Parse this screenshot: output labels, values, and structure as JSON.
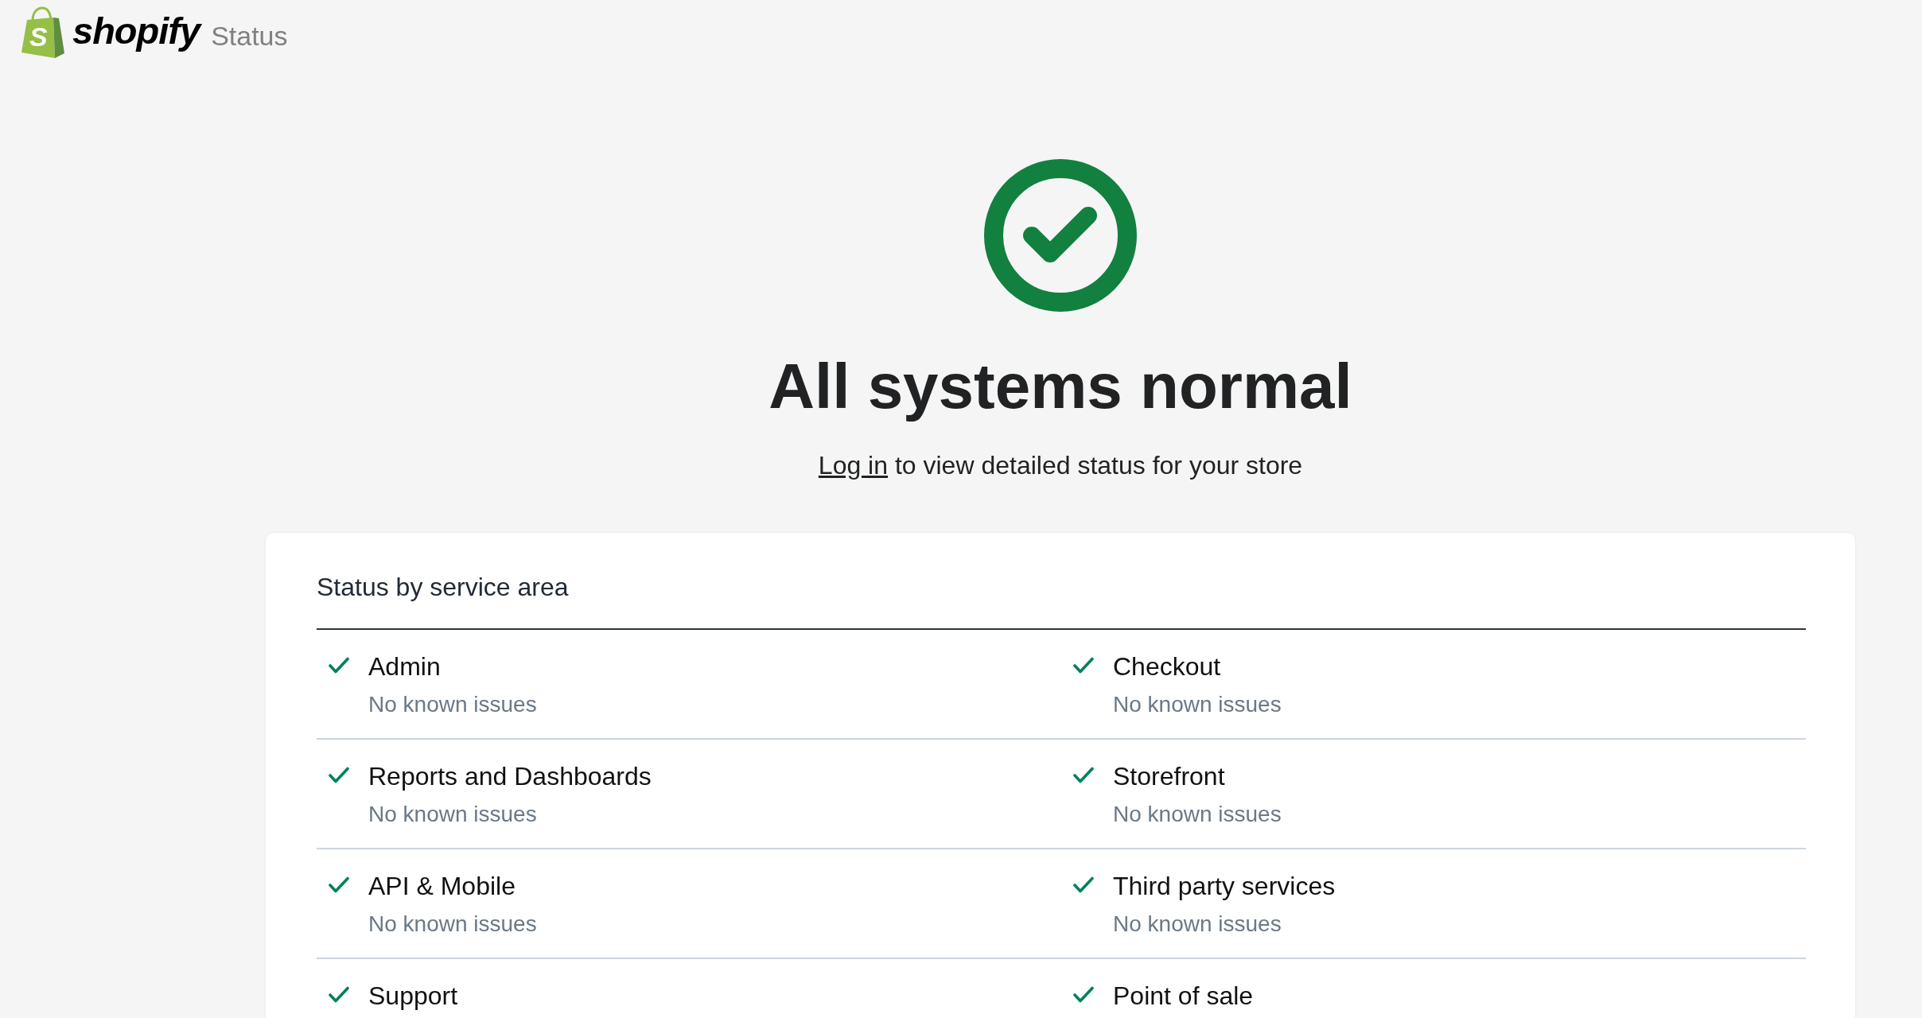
{
  "header": {
    "logo_mark": "S",
    "wordmark": "shopify",
    "product": "Status"
  },
  "hero": {
    "operational": true,
    "title": "All systems normal",
    "login_link": "Log in",
    "login_text": "to view detailed status for your store"
  },
  "card": {
    "title": "Status by service area",
    "services": [
      {
        "name": "Admin",
        "operational": true,
        "description": "No known issues"
      },
      {
        "name": "Checkout",
        "operational": true,
        "description": "No known issues"
      },
      {
        "name": "Reports and Dashboards",
        "operational": true,
        "description": "No known issues"
      },
      {
        "name": "Storefront",
        "operational": true,
        "description": "No known issues"
      },
      {
        "name": "API & Mobile",
        "operational": true,
        "description": "No known issues"
      },
      {
        "name": "Third party services",
        "operational": true,
        "description": "No known issues"
      },
      {
        "name": "Support",
        "operational": true
      },
      {
        "name": "Point of sale",
        "operational": true
      }
    ]
  }
}
